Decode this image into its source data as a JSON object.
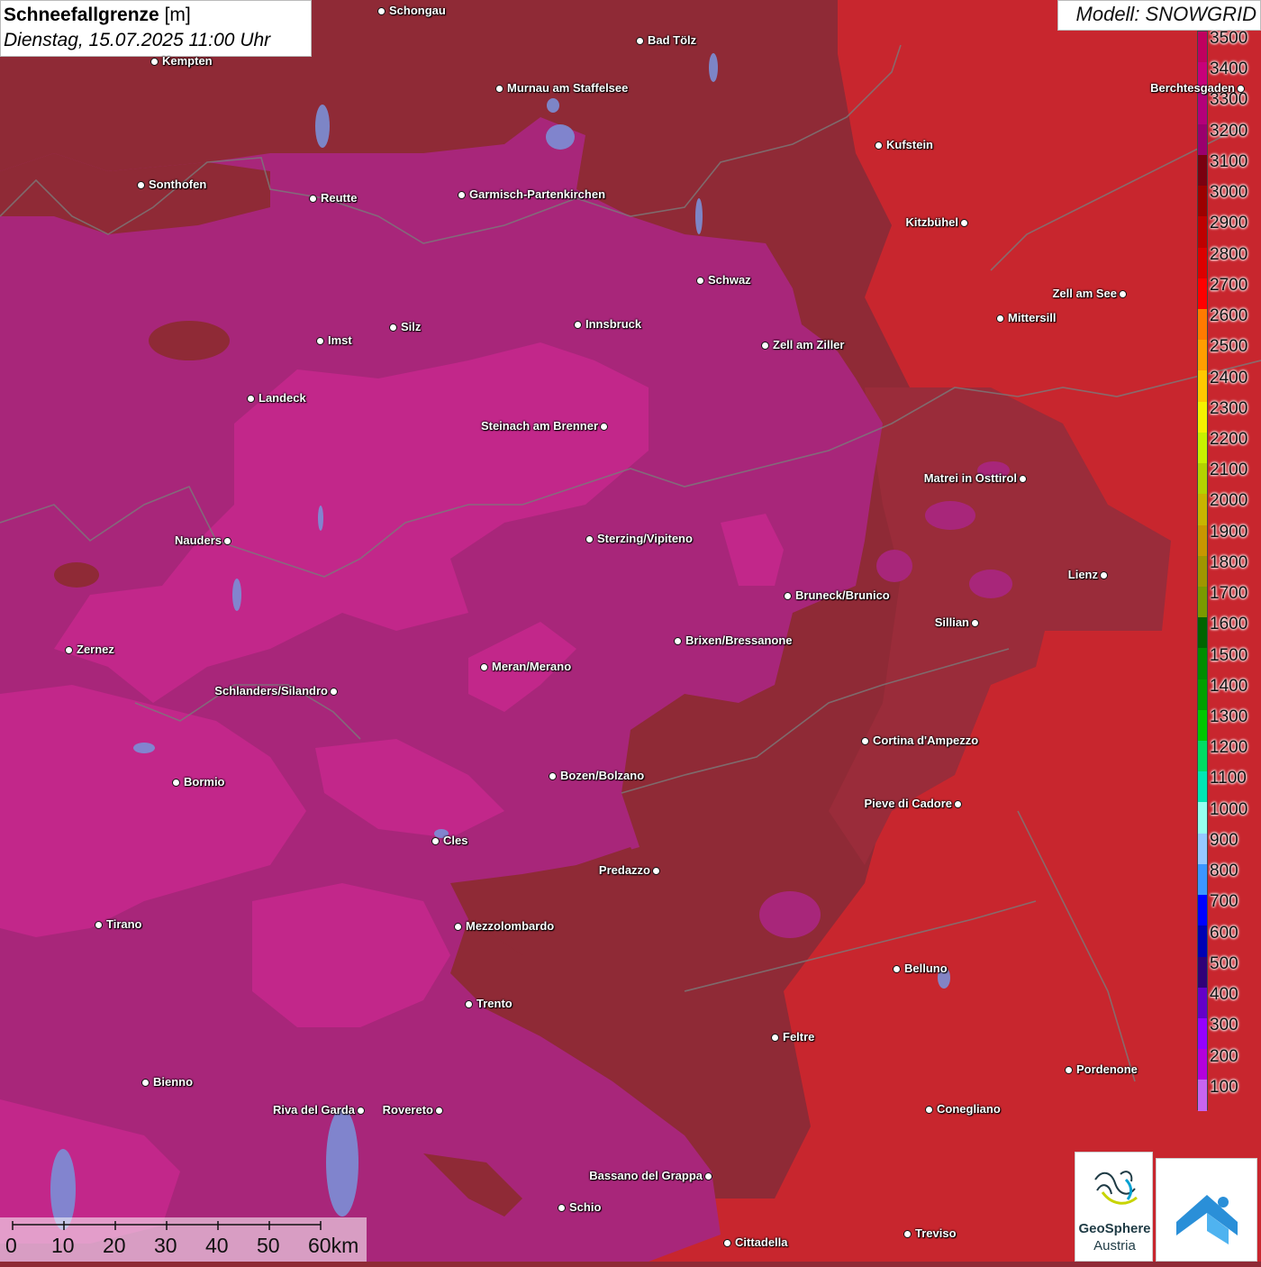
{
  "title": {
    "main": "Schneefallgrenze",
    "unit": "[m]",
    "datetime": "Dienstag, 15.07.2025 11:00 Uhr"
  },
  "model": "Modell: SNOWGRID",
  "legend": {
    "levels": [
      "3500",
      "3400",
      "3300",
      "3200",
      "3100",
      "3000",
      "2900",
      "2800",
      "2700",
      "2600",
      "2500",
      "2400",
      "2300",
      "2200",
      "2100",
      "2000",
      "1900",
      "1800",
      "1700",
      "1600",
      "1500",
      "1400",
      "1300",
      "1200",
      "1100",
      "1000",
      "900",
      "800",
      "700",
      "600",
      "500",
      "400",
      "300",
      "200",
      "100"
    ],
    "colors": [
      "#c0005f",
      "#c8007a",
      "#b4007a",
      "#9a006e",
      "#7a0010",
      "#9c0000",
      "#be0000",
      "#dc0000",
      "#ff0000",
      "#ff7a00",
      "#ff9e00",
      "#ffc800",
      "#f5f000",
      "#c8f000",
      "#b4d200",
      "#c8b400",
      "#c89600",
      "#a09600",
      "#7a9a00",
      "#006400",
      "#008c00",
      "#00a000",
      "#00c800",
      "#00dc64",
      "#00e6b4",
      "#96fff0",
      "#96c8ff",
      "#3c96ff",
      "#0000ff",
      "#0000b4",
      "#300078",
      "#6400c8",
      "#9600ff",
      "#b400dc",
      "#c864f0"
    ]
  },
  "cities": [
    {
      "name": "Schongau",
      "side": "r"
    },
    {
      "name": "Bad Tölz",
      "side": "r"
    },
    {
      "name": "Kempten",
      "side": "r"
    },
    {
      "name": "Murnau am Staffelsee",
      "side": "r"
    },
    {
      "name": "Berchtesgaden",
      "side": "l"
    },
    {
      "name": "Kufstein",
      "side": "r"
    },
    {
      "name": "Sonthofen",
      "side": "r"
    },
    {
      "name": "Reutte",
      "side": "r"
    },
    {
      "name": "Garmisch-Partenkirchen",
      "side": "r"
    },
    {
      "name": "Kitzbühel",
      "side": "l"
    },
    {
      "name": "Schwaz",
      "side": "r"
    },
    {
      "name": "Zell am See",
      "side": "l"
    },
    {
      "name": "Mittersill",
      "side": "r"
    },
    {
      "name": "Innsbruck",
      "side": "r"
    },
    {
      "name": "Imst",
      "side": "r"
    },
    {
      "name": "Silz",
      "side": "r"
    },
    {
      "name": "Zell am Ziller",
      "side": "r"
    },
    {
      "name": "Landeck",
      "side": "r"
    },
    {
      "name": "Steinach am Brenner",
      "side": "l"
    },
    {
      "name": "Matrei in Osttirol",
      "side": "l"
    },
    {
      "name": "Nauders",
      "side": "l"
    },
    {
      "name": "Sterzing/Vipiteno",
      "side": "r"
    },
    {
      "name": "Lienz",
      "side": "l"
    },
    {
      "name": "Bruneck/Brunico",
      "side": "r"
    },
    {
      "name": "Sillian",
      "side": "l"
    },
    {
      "name": "Zernez",
      "side": "r"
    },
    {
      "name": "Brixen/Bressanone",
      "side": "r"
    },
    {
      "name": "Meran/Merano",
      "side": "r"
    },
    {
      "name": "Schlanders/Silandro",
      "side": "l"
    },
    {
      "name": "Cortina d'Ampezzo",
      "side": "r"
    },
    {
      "name": "Bozen/Bolzano",
      "side": "r"
    },
    {
      "name": "Bormio",
      "side": "r"
    },
    {
      "name": "Pieve di Cadore",
      "side": "l"
    },
    {
      "name": "Cles",
      "side": "r"
    },
    {
      "name": "Predazzo",
      "side": "l"
    },
    {
      "name": "Tirano",
      "side": "r"
    },
    {
      "name": "Mezzolombardo",
      "side": "r"
    },
    {
      "name": "Belluno",
      "side": "r"
    },
    {
      "name": "Trento",
      "side": "r"
    },
    {
      "name": "Feltre",
      "side": "r"
    },
    {
      "name": "Pordenone",
      "side": "r"
    },
    {
      "name": "Bienno",
      "side": "r"
    },
    {
      "name": "Riva del Garda",
      "side": "l"
    },
    {
      "name": "Rovereto",
      "side": "l"
    },
    {
      "name": "Conegliano",
      "side": "r"
    },
    {
      "name": "Bassano del Grappa",
      "side": "l"
    },
    {
      "name": "Schio",
      "side": "r"
    },
    {
      "name": "Treviso",
      "side": "r"
    },
    {
      "name": "Cittadella",
      "side": "r"
    }
  ],
  "scalebar": {
    "labels": [
      "0",
      "10",
      "20",
      "30",
      "40",
      "50",
      "60km"
    ]
  },
  "logo": {
    "name": "GeoSphere",
    "sub": "Austria"
  }
}
